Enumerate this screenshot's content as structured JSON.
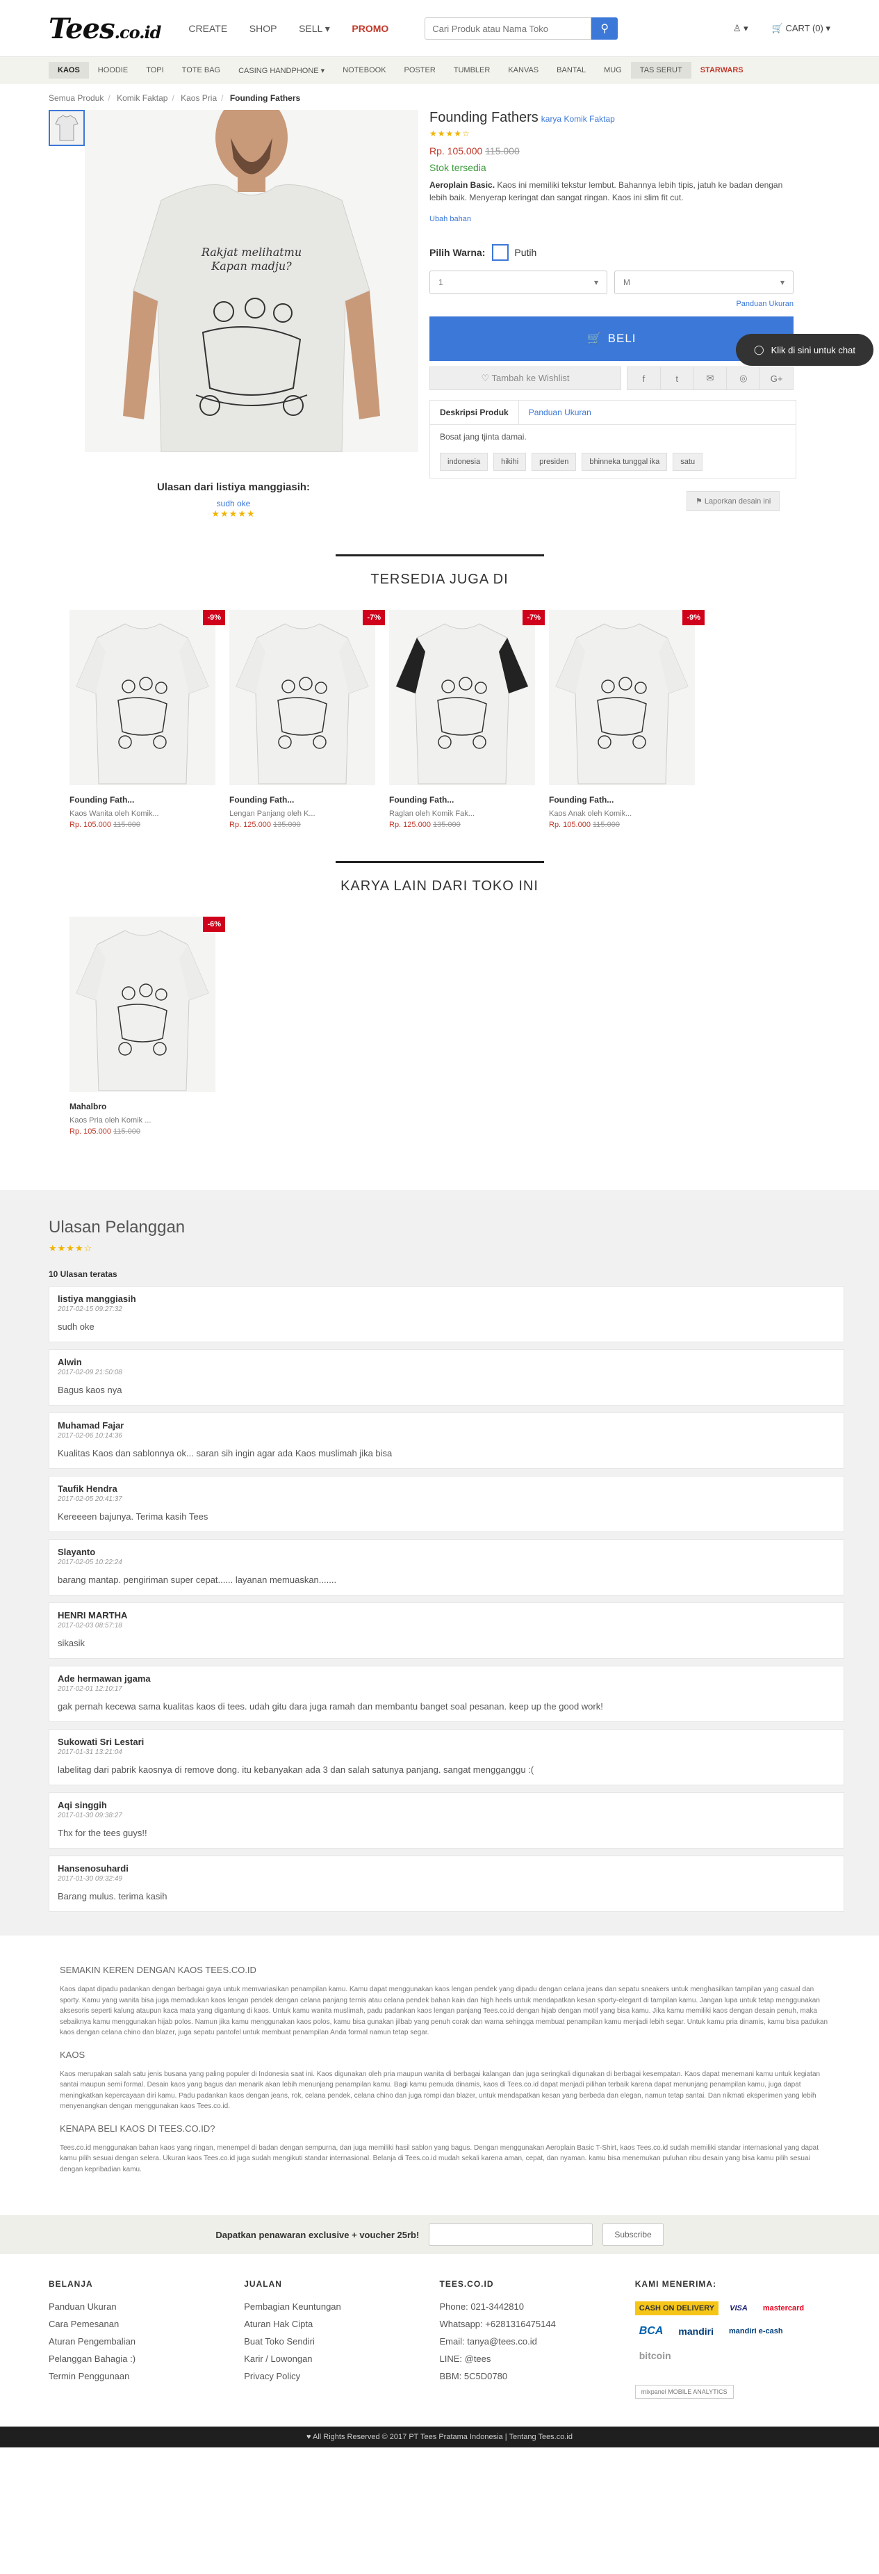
{
  "header": {
    "logo": "Tees",
    "logo_suffix": ".co.id",
    "nav": [
      "CREATE",
      "SHOP",
      "SELL ▾",
      "PROMO"
    ],
    "search_placeholder": "Cari Produk atau Nama Toko",
    "account": "▾",
    "cart": "CART (0) ▾"
  },
  "categories": [
    "KAOS",
    "HOODIE",
    "TOPI",
    "TOTE BAG",
    "CASING HANDPHONE ▾",
    "NOTEBOOK",
    "POSTER",
    "TUMBLER",
    "KANVAS",
    "BANTAL",
    "MUG",
    "TAS SERUT",
    "STARWARS"
  ],
  "breadcrumb": [
    "Semua Produk",
    "Komik Faktap",
    "Kaos Pria",
    "Founding Fathers"
  ],
  "product": {
    "title": "Founding Fathers",
    "by": "karya Komik Faktap",
    "rating_stars": "★★★★☆",
    "price": "Rp. 105.000",
    "old_price": "115.000",
    "stock": "Stok tersedia",
    "desc_bold": "Aeroplain Basic.",
    "desc": " Kaos ini memiliki tekstur lembut. Bahannya lebih tipis, jatuh ke badan dengan lebih baik. Menyerap keringat dan sangat ringan. Kaos ini slim fit cut.",
    "change_material": "Ubah bahan",
    "color_label": "Pilih Warna:",
    "color_name": "Putih",
    "qty": "1",
    "size": "M",
    "size_guide": "Panduan Ukuran",
    "buy_label": "BELI",
    "wishlist": "♡ Tambah ke Wishlist",
    "share": [
      "f",
      "t",
      "✉",
      "◎",
      "G+"
    ],
    "tab_desc": "Deskripsi Produk",
    "tab_size": "Panduan Ukuran",
    "description_text": "Bosat jang tjinta damai.",
    "tags": [
      "indonesia",
      "hikihi",
      "presiden",
      "bhinneka tunggal ika",
      "satu"
    ],
    "report": "⚑ Laporkan desain ini",
    "chat": "Klik di sini untuk chat",
    "review_highlight_title": "Ulasan dari listiya manggiasih:",
    "review_highlight_user": "sudh oke",
    "review_highlight_stars": "★★★★★"
  },
  "also_available": {
    "title": "TERSEDIA JUGA DI",
    "items": [
      {
        "name": "Founding Fath...",
        "meta": "Kaos Wanita oleh Komik...",
        "price": "Rp. 105.000",
        "old": "115.000",
        "disc": "-9%"
      },
      {
        "name": "Founding Fath...",
        "meta": "Lengan Panjang oleh K...",
        "price": "Rp. 125.000",
        "old": "135.000",
        "disc": "-7%"
      },
      {
        "name": "Founding Fath...",
        "meta": "Raglan oleh Komik Fak...",
        "price": "Rp. 125.000",
        "old": "135.000",
        "disc": "-7%"
      },
      {
        "name": "Founding Fath...",
        "meta": "Kaos Anak oleh Komik...",
        "price": "Rp. 105.000",
        "old": "115.000",
        "disc": "-9%"
      }
    ]
  },
  "other_works": {
    "title": "KARYA LAIN DARI TOKO INI",
    "items": [
      {
        "name": "Mahalbro",
        "meta": "Kaos Pria oleh Komik ...",
        "price": "Rp. 105.000",
        "old": "115.000",
        "disc": "-6%"
      }
    ]
  },
  "reviews": {
    "title": "Ulasan Pelanggan",
    "stars": "★★★★☆",
    "count_label": "10 Ulasan teratas",
    "items": [
      {
        "name": "listiya manggiasih",
        "date": "2017-02-15 09:27:32",
        "text": "sudh oke"
      },
      {
        "name": "Alwin",
        "date": "2017-02-09 21:50:08",
        "text": "Bagus kaos nya"
      },
      {
        "name": "Muhamad Fajar",
        "date": "2017-02-06 10:14:36",
        "text": "Kualitas Kaos dan sablonnya ok... saran sih ingin agar ada Kaos muslimah jika bisa"
      },
      {
        "name": "Taufik Hendra",
        "date": "2017-02-05 20:41:37",
        "text": "Kereeeen bajunya. Terima kasih Tees"
      },
      {
        "name": "Slayanto",
        "date": "2017-02-05 10:22:24",
        "text": "barang mantap. pengiriman super cepat...... layanan memuaskan......."
      },
      {
        "name": "HENRI MARTHA",
        "date": "2017-02-03 08:57:18",
        "text": "sikasik"
      },
      {
        "name": "Ade hermawan jgama",
        "date": "2017-02-01 12:10:17",
        "text": "gak pernah kecewa sama kualitas kaos di tees. udah gitu dara juga ramah dan membantu banget soal pesanan. keep up the good work!"
      },
      {
        "name": "Sukowati Sri Lestari",
        "date": "2017-01-31 13:21:04",
        "text": "labelitag dari pabrik kaosnya di remove dong. itu kebanyakan ada 3 dan salah satunya panjang. sangat mengganggu :("
      },
      {
        "name": "Aqi singgih",
        "date": "2017-01-30 09:38:27",
        "text": "Thx for the tees guys!!"
      },
      {
        "name": "Hansenosuhardi",
        "date": "2017-01-30 09:32:49",
        "text": "Barang mulus. terima kasih"
      }
    ]
  },
  "seo": [
    {
      "h": "SEMAKIN KEREN DENGAN KAOS TEES.CO.ID",
      "p": "Kaos dapat dipadu padankan dengan berbagai gaya untuk memvariasikan penampilan kamu. Kamu dapat menggunakan kaos lengan pendek yang dipadu dengan celana jeans dan sepatu sneakers untuk menghasilkan tampilan yang casual dan sporty. Kamu yang wanita bisa juga memadukan kaos lengan pendek dengan celana panjang ternis atau celana pendek bahan kain dan high heels untuk mendapatkan kesan sporty-elegant di tampilan kamu. Jangan lupa untuk tetap menggunakan aksesoris seperti kalung ataupun kaca mata yang digantung di kaos. Untuk kamu wanita muslimah, padu padankan kaos lengan panjang Tees.co.id dengan hijab dengan motif yang bisa kamu. Jika kamu memiliki kaos dengan desain penuh, maka sebaiknya kamu menggunakan hijab polos. Namun jika kamu menggunakan kaos polos, kamu bisa gunakan jilbab yang penuh corak dan warna sehingga membuat penampilan kamu menjadi lebih segar. Untuk kamu pria dinamis, kamu bisa padukan kaos dengan celana chino dan blazer, juga sepatu pantofel untuk membuat penampilan Anda formal namun tetap segar."
    },
    {
      "h": "KAOS",
      "p": "Kaos merupakan salah satu jenis busana yang paling populer di Indonesia saat ini. Kaos digunakan oleh pria maupun wanita di berbagai kalangan dan juga seringkali digunakan di berbagai kesempatan. Kaos dapat menemani kamu untuk kegiatan santai maupun semi formal. Desain kaos yang bagus dan menarik akan lebih menunjang penampilan kamu. Bagi kamu pemuda dinamis, kaos di Tees.co.id dapat menjadi pilihan terbaik karena dapat menunjang penampilan kamu, juga dapat meningkatkan kepercayaan diri kamu. Padu padankan kaos dengan jeans, rok, celana pendek, celana chino dan juga rompi dan blazer, untuk mendapatkan kesan yang berbeda dan elegan, namun tetap santai. Dan nikmati eksperimen yang lebih menyenangkan dengan menggunakan kaos Tees.co.id."
    },
    {
      "h": "KENAPA BELI KAOS DI TEES.CO.ID?",
      "p": "Tees.co.id menggunakan bahan kaos yang ringan, menempel di badan dengan sempurna, dan juga memiliki hasil sablon yang bagus. Dengan menggunakan Aeroplain Basic T-Shirt, kaos Tees.co.id sudah memiliki standar internasional yang dapat kamu pilih sesuai dengan selera. Ukuran kaos Tees.co.id juga sudah mengikuti standar internasional. Belanja di Tees.co.id mudah sekali karena aman, cepat, dan nyaman. kamu bisa menemukan puluhan ribu desain yang bisa kamu pilih sesuai dengan kepribadian kamu."
    }
  ],
  "newsletter": {
    "label": "Dapatkan penawaran exclusive + voucher 25rb!",
    "button": "Subscribe"
  },
  "footer": {
    "cols": [
      {
        "h": "BELANJA",
        "items": [
          "Panduan Ukuran",
          "Cara Pemesanan",
          "Aturan Pengembalian",
          "Pelanggan Bahagia :)",
          "Termin Penggunaan"
        ]
      },
      {
        "h": "JUALAN",
        "items": [
          "Pembagian Keuntungan",
          "Aturan Hak Cipta",
          "Buat Toko Sendiri",
          "Karir / Lowongan",
          "Privacy Policy"
        ]
      },
      {
        "h": "TEES.CO.ID",
        "items": [
          "Phone: 021-3442810",
          "Whatsapp: +6281316475144",
          "Email: tanya@tees.co.id",
          "LINE: @tees",
          "BBM: 5C5D0780"
        ]
      },
      {
        "h": "KAMI MENERIMA:",
        "items": [
          "CASH ON DELIVERY",
          "VISA",
          "mastercard",
          "BCA",
          "mandiri",
          "mandiri e-cash",
          "bitcoin"
        ]
      }
    ],
    "mixpanel": "mixpanel MOBILE ANALYTICS",
    "copyright": "♥ All Rights Reserved © 2017 PT Tees Pratama Indonesia | Tentang Tees.co.id"
  },
  "colors": {
    "accent": "#3c78d8",
    "price": "#c0392b",
    "discount": "#d0021b"
  }
}
